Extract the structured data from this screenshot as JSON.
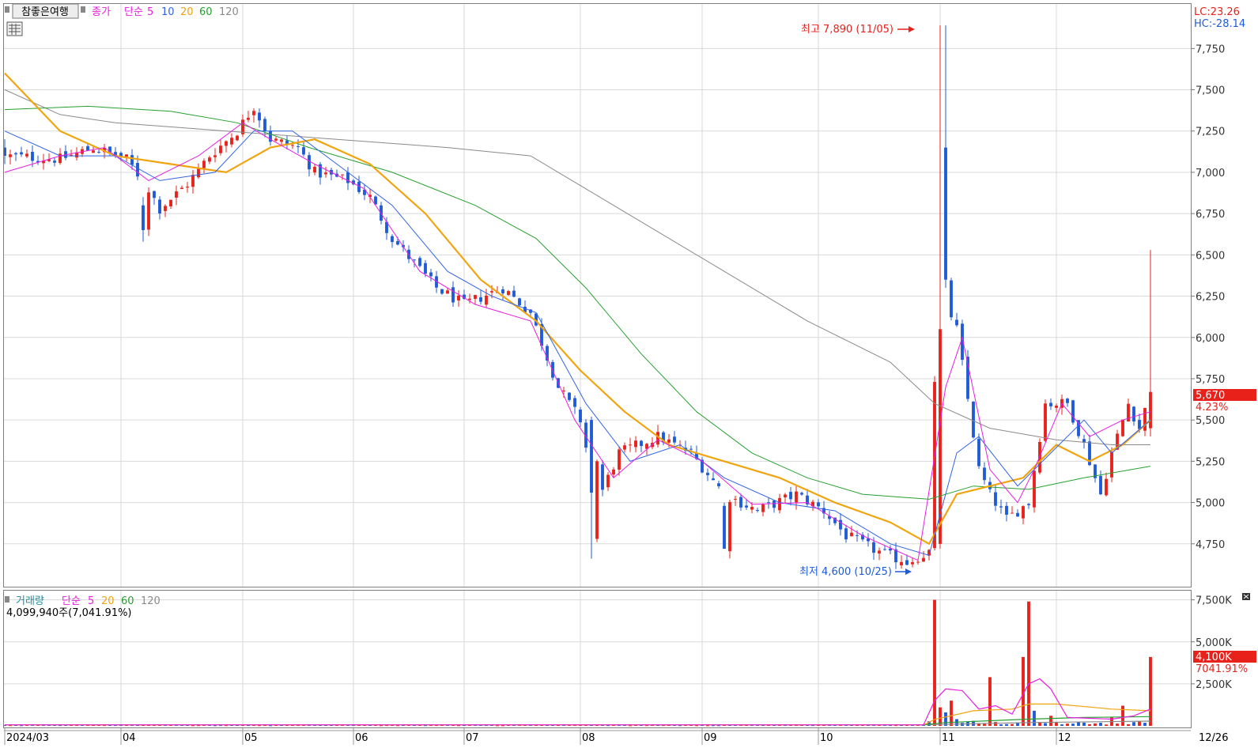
{
  "legend": {
    "stock_name": "참좋은여행",
    "price_legend": [
      "종가",
      "단순",
      "5",
      "10",
      "20",
      "60",
      "120"
    ],
    "volume_legend": [
      "거래량",
      "단순",
      "5",
      "20",
      "60",
      "120"
    ],
    "volume_info": "4,099,940주(7,041.91%)"
  },
  "lc_label": "LC:23.26",
  "hc_label": "HC:-28.14",
  "max_annotation": "최고 7,890 (11/05)",
  "min_annotation": "최저 4,600 (10/25)",
  "last_price_tag": "5,670",
  "last_change_tag": "4.23%",
  "last_volume_tag": "4,100K",
  "last_volume_change_tag": "7041.91%",
  "end_date_label": "12/26",
  "colors": {
    "up": "#e8211b",
    "down": "#1f5bd6",
    "ma5": "#e91ee0",
    "ma10": "#2f63e8",
    "ma20": "#f0a40f",
    "ma60": "#27a02f",
    "ma120": "#8a8a8a",
    "grid": "#d9d9d9"
  },
  "chart_data": [
    {
      "type": "candlestick",
      "title": "참좋은여행",
      "ylim": [
        4500,
        7900
      ],
      "y_ticks": [
        4750,
        5000,
        5250,
        5500,
        5750,
        6000,
        6250,
        6500,
        6750,
        7000,
        7250,
        7500,
        7750
      ],
      "y_tick_labels": [
        "4,750",
        "5,000",
        "5,250",
        "5,500",
        "5,750",
        "6,000",
        "6,250",
        "6,500",
        "6,750",
        "7,000",
        "7,250",
        "7,500",
        "7,750"
      ],
      "month_labels": [
        "2024/03",
        "04",
        "05",
        "06",
        "07",
        "08",
        "09",
        "10",
        "11",
        "12"
      ],
      "month_start_index": [
        0,
        21,
        43,
        63,
        83,
        104,
        126,
        147,
        169,
        190
      ],
      "last_index": 207,
      "ohlc_waypoints": [
        {
          "i": 0,
          "c": 7100
        },
        {
          "i": 10,
          "c": 7080
        },
        {
          "i": 16,
          "c": 7150
        },
        {
          "i": 22,
          "c": 7080
        },
        {
          "i": 26,
          "c": 6900
        },
        {
          "i": 28,
          "c": 6780
        },
        {
          "i": 33,
          "c": 6930
        },
        {
          "i": 37,
          "c": 7100
        },
        {
          "i": 42,
          "c": 7250
        },
        {
          "i": 45,
          "c": 7400
        },
        {
          "i": 48,
          "c": 7200
        },
        {
          "i": 53,
          "c": 7150
        },
        {
          "i": 56,
          "c": 7000
        },
        {
          "i": 62,
          "c": 6950
        },
        {
          "i": 66,
          "c": 6850
        },
        {
          "i": 70,
          "c": 6600
        },
        {
          "i": 78,
          "c": 6300
        },
        {
          "i": 83,
          "c": 6200
        },
        {
          "i": 90,
          "c": 6300
        },
        {
          "i": 95,
          "c": 6150
        },
        {
          "i": 100,
          "c": 5700
        },
        {
          "i": 104,
          "c": 5500
        },
        {
          "i": 107,
          "c": 5000
        },
        {
          "i": 111,
          "c": 5300
        },
        {
          "i": 118,
          "c": 5400
        },
        {
          "i": 124,
          "c": 5300
        },
        {
          "i": 130,
          "c": 5050
        },
        {
          "i": 136,
          "c": 4950
        },
        {
          "i": 143,
          "c": 5050
        },
        {
          "i": 148,
          "c": 4950
        },
        {
          "i": 152,
          "c": 4800
        },
        {
          "i": 158,
          "c": 4700
        },
        {
          "i": 163,
          "c": 4640
        },
        {
          "i": 167,
          "c": 4700
        },
        {
          "i": 168,
          "c": 5700
        },
        {
          "i": 169,
          "c": 6300
        },
        {
          "i": 172,
          "c": 6050
        },
        {
          "i": 176,
          "c": 5200
        },
        {
          "i": 178,
          "c": 5050
        },
        {
          "i": 181,
          "c": 4900
        },
        {
          "i": 185,
          "c": 5000
        },
        {
          "i": 188,
          "c": 5600
        },
        {
          "i": 192,
          "c": 5600
        },
        {
          "i": 195,
          "c": 5350
        },
        {
          "i": 198,
          "c": 5050
        },
        {
          "i": 200,
          "c": 5300
        },
        {
          "i": 203,
          "c": 5600
        },
        {
          "i": 205,
          "c": 5450
        },
        {
          "i": 207,
          "c": 5670
        }
      ],
      "special_bars": [
        {
          "i": 169,
          "o": 4750,
          "h": 7890,
          "l": 4720,
          "c": 6050
        },
        {
          "i": 170,
          "o": 7150,
          "h": 7890,
          "l": 6300,
          "c": 6350
        },
        {
          "i": 0,
          "o": 7150,
          "h": 7200,
          "l": 7050,
          "c": 7100
        },
        {
          "i": 25,
          "o": 6800,
          "h": 6850,
          "l": 6580,
          "c": 6650
        },
        {
          "i": 106,
          "o": 5500,
          "h": 5520,
          "l": 4660,
          "c": 5060
        },
        {
          "i": 107,
          "o": 4780,
          "h": 5260,
          "l": 4760,
          "c": 5250
        },
        {
          "i": 130,
          "o": 4980,
          "h": 5000,
          "l": 4720,
          "c": 4720
        },
        {
          "i": 162,
          "o": 4620,
          "h": 4680,
          "l": 4600,
          "c": 4640
        },
        {
          "i": 207,
          "o": 5450,
          "h": 6530,
          "l": 5400,
          "c": 5670
        }
      ],
      "ma5": [
        [
          0,
          7000
        ],
        [
          10,
          7100
        ],
        [
          18,
          7150
        ],
        [
          26,
          6950
        ],
        [
          35,
          7100
        ],
        [
          43,
          7300
        ],
        [
          48,
          7200
        ],
        [
          56,
          7050
        ],
        [
          65,
          6900
        ],
        [
          75,
          6400
        ],
        [
          85,
          6200
        ],
        [
          95,
          6100
        ],
        [
          103,
          5500
        ],
        [
          110,
          5150
        ],
        [
          118,
          5380
        ],
        [
          126,
          5250
        ],
        [
          135,
          4990
        ],
        [
          145,
          5000
        ],
        [
          155,
          4800
        ],
        [
          165,
          4650
        ],
        [
          170,
          5700
        ],
        [
          173,
          6000
        ],
        [
          178,
          5200
        ],
        [
          183,
          5000
        ],
        [
          186,
          5200
        ],
        [
          191,
          5600
        ],
        [
          196,
          5400
        ],
        [
          202,
          5500
        ],
        [
          207,
          5550
        ]
      ],
      "ma10": [
        [
          0,
          7250
        ],
        [
          10,
          7100
        ],
        [
          20,
          7100
        ],
        [
          28,
          6950
        ],
        [
          38,
          7000
        ],
        [
          45,
          7250
        ],
        [
          52,
          7250
        ],
        [
          60,
          7050
        ],
        [
          70,
          6800
        ],
        [
          80,
          6400
        ],
        [
          88,
          6250
        ],
        [
          96,
          6150
        ],
        [
          105,
          5600
        ],
        [
          113,
          5250
        ],
        [
          122,
          5350
        ],
        [
          130,
          5150
        ],
        [
          140,
          5000
        ],
        [
          150,
          4950
        ],
        [
          160,
          4750
        ],
        [
          167,
          4680
        ],
        [
          172,
          5300
        ],
        [
          176,
          5400
        ],
        [
          183,
          5100
        ],
        [
          189,
          5300
        ],
        [
          195,
          5500
        ],
        [
          200,
          5300
        ],
        [
          207,
          5500
        ]
      ],
      "ma20": [
        [
          0,
          7600
        ],
        [
          10,
          7250
        ],
        [
          20,
          7100
        ],
        [
          30,
          7050
        ],
        [
          40,
          7000
        ],
        [
          48,
          7150
        ],
        [
          56,
          7200
        ],
        [
          66,
          7050
        ],
        [
          76,
          6750
        ],
        [
          86,
          6350
        ],
        [
          96,
          6100
        ],
        [
          104,
          5800
        ],
        [
          112,
          5550
        ],
        [
          120,
          5350
        ],
        [
          130,
          5250
        ],
        [
          140,
          5150
        ],
        [
          150,
          5000
        ],
        [
          160,
          4880
        ],
        [
          167,
          4750
        ],
        [
          172,
          5050
        ],
        [
          178,
          5100
        ],
        [
          184,
          5150
        ],
        [
          190,
          5350
        ],
        [
          196,
          5250
        ],
        [
          202,
          5350
        ],
        [
          207,
          5500
        ]
      ],
      "ma60": [
        [
          0,
          7380
        ],
        [
          15,
          7400
        ],
        [
          30,
          7370
        ],
        [
          42,
          7300
        ],
        [
          55,
          7150
        ],
        [
          70,
          7000
        ],
        [
          85,
          6800
        ],
        [
          96,
          6600
        ],
        [
          105,
          6300
        ],
        [
          115,
          5900
        ],
        [
          125,
          5550
        ],
        [
          135,
          5300
        ],
        [
          145,
          5150
        ],
        [
          155,
          5050
        ],
        [
          167,
          5020
        ],
        [
          175,
          5100
        ],
        [
          185,
          5080
        ],
        [
          195,
          5150
        ],
        [
          207,
          5220
        ]
      ],
      "ma120": [
        [
          0,
          7500
        ],
        [
          10,
          7350
        ],
        [
          20,
          7300
        ],
        [
          40,
          7250
        ],
        [
          60,
          7200
        ],
        [
          80,
          7150
        ],
        [
          95,
          7100
        ],
        [
          105,
          6900
        ],
        [
          115,
          6700
        ],
        [
          130,
          6400
        ],
        [
          145,
          6100
        ],
        [
          160,
          5850
        ],
        [
          168,
          5600
        ],
        [
          178,
          5450
        ],
        [
          190,
          5380
        ],
        [
          200,
          5350
        ],
        [
          207,
          5350
        ]
      ]
    },
    {
      "type": "bar",
      "title": "거래량",
      "ylim": [
        0,
        8000000
      ],
      "y_ticks": [
        2500000,
        5000000,
        7500000
      ],
      "y_tick_labels": [
        "2,500K",
        "5,000K",
        "7,500K"
      ],
      "volume_spikes": [
        {
          "i": 168,
          "v": 7500000,
          "up": true
        },
        {
          "i": 169,
          "v": 1100000,
          "up": true
        },
        {
          "i": 170,
          "v": 800000,
          "up": false
        },
        {
          "i": 171,
          "v": 1500000,
          "up": true
        },
        {
          "i": 172,
          "v": 400000,
          "up": false
        },
        {
          "i": 175,
          "v": 300000,
          "up": false
        },
        {
          "i": 178,
          "v": 2900000,
          "up": true
        },
        {
          "i": 184,
          "v": 4100000,
          "up": true
        },
        {
          "i": 185,
          "v": 7400000,
          "up": true
        },
        {
          "i": 186,
          "v": 900000,
          "up": false
        },
        {
          "i": 189,
          "v": 600000,
          "up": true
        },
        {
          "i": 200,
          "v": 500000,
          "up": true
        },
        {
          "i": 202,
          "v": 1200000,
          "up": true
        },
        {
          "i": 207,
          "v": 4100000,
          "up": true
        }
      ],
      "base_volume": 60000,
      "vma5": [
        [
          0,
          60000
        ],
        [
          166,
          60000
        ],
        [
          168,
          1500000
        ],
        [
          170,
          2200000
        ],
        [
          173,
          2100000
        ],
        [
          176,
          1000000
        ],
        [
          179,
          1200000
        ],
        [
          182,
          700000
        ],
        [
          185,
          2500000
        ],
        [
          187,
          2800000
        ],
        [
          189,
          2200000
        ],
        [
          192,
          500000
        ],
        [
          200,
          400000
        ],
        [
          204,
          600000
        ],
        [
          207,
          1000000
        ]
      ],
      "vma20": [
        [
          0,
          60000
        ],
        [
          166,
          60000
        ],
        [
          168,
          380000
        ],
        [
          175,
          900000
        ],
        [
          182,
          1000000
        ],
        [
          185,
          1300000
        ],
        [
          190,
          1300000
        ],
        [
          200,
          1000000
        ],
        [
          207,
          900000
        ]
      ],
      "vma60": [
        [
          0,
          60000
        ],
        [
          166,
          60000
        ],
        [
          170,
          200000
        ],
        [
          185,
          400000
        ],
        [
          195,
          500000
        ],
        [
          207,
          550000
        ]
      ],
      "vma120": [
        [
          0,
          60000
        ],
        [
          166,
          60000
        ],
        [
          185,
          200000
        ],
        [
          207,
          280000
        ]
      ]
    }
  ]
}
